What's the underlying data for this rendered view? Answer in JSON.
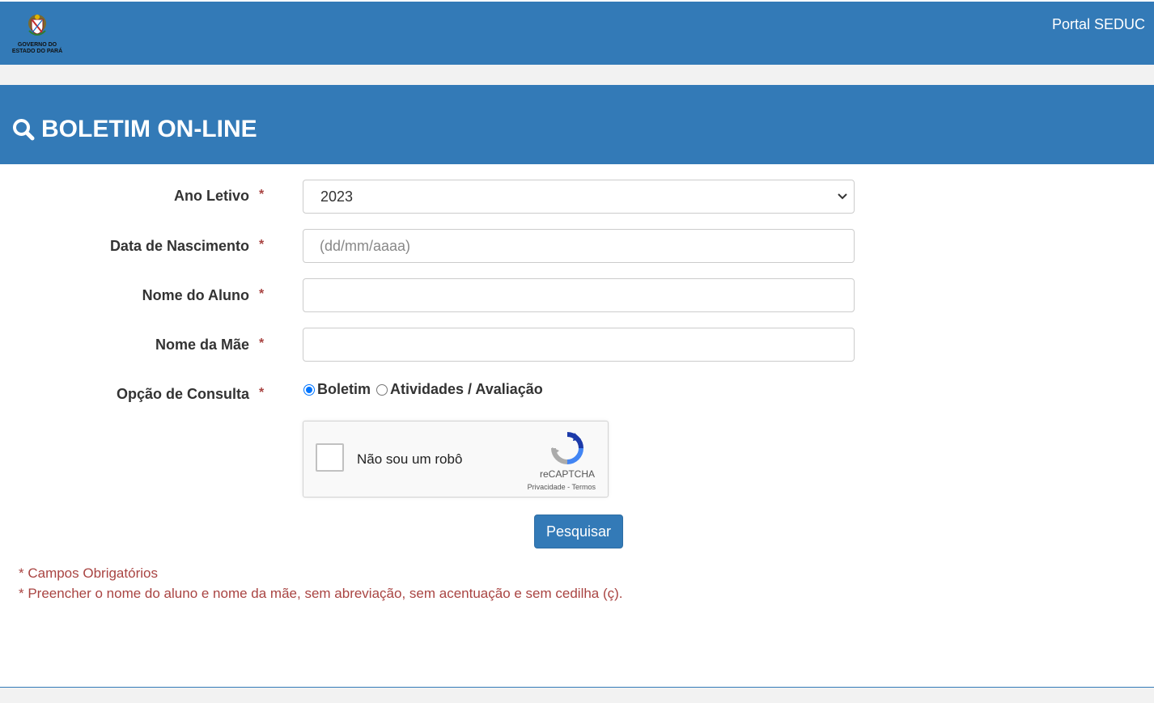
{
  "header": {
    "logo_text_line1": "GOVERNO DO",
    "logo_text_line2": "ESTADO DO PARÁ",
    "portal_link": "Portal SEDUC"
  },
  "page": {
    "title": "BOLETIM ON-LINE"
  },
  "form": {
    "ano_letivo_label": "Ano Letivo",
    "ano_letivo_value": "2023",
    "data_nascimento_label": "Data de Nascimento",
    "data_nascimento_placeholder": "(dd/mm/aaaa)",
    "nome_aluno_label": "Nome do Aluno",
    "nome_aluno_value": "",
    "nome_mae_label": "Nome da Mãe",
    "nome_mae_value": "",
    "opcao_label": "Opção de Consulta",
    "required_mark": "*",
    "options": [
      {
        "label": "Boletim",
        "checked": true
      },
      {
        "label": "Atividades / Avaliação",
        "checked": false
      }
    ],
    "submit_label": "Pesquisar"
  },
  "captcha": {
    "text": "Não sou um robô",
    "brand": "reCAPTCHA",
    "links": "Privacidade - Termos"
  },
  "notes": [
    "* Campos Obrigatórios",
    "* Preencher o nome do aluno e nome da mãe, sem abreviação, sem acentuação e sem cedilha (ç)."
  ],
  "colors": {
    "primary": "#337ab7",
    "error_text": "#a94442"
  }
}
